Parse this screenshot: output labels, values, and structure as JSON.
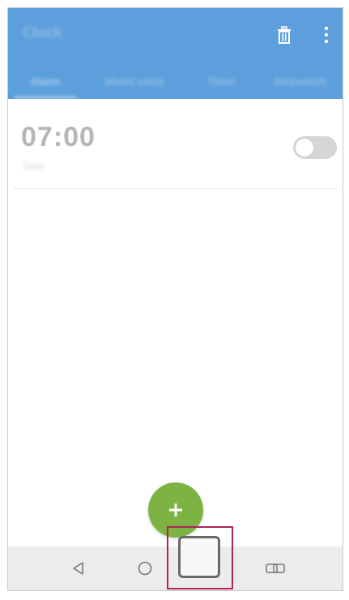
{
  "appbar": {
    "title": "Clock",
    "tabs": [
      {
        "label": "Alarm",
        "active": true
      },
      {
        "label": "World clock",
        "active": false
      },
      {
        "label": "Timer",
        "active": false
      },
      {
        "label": "Stopwatch",
        "active": false
      }
    ],
    "actions": {
      "delete_icon": "trash-icon",
      "more_icon": "more-vert-icon"
    },
    "color": "#5d9fdc"
  },
  "alarms": [
    {
      "time": "07:00",
      "label": "Daily",
      "enabled": false
    }
  ],
  "fab": {
    "icon": "plus-icon",
    "color": "#7cb342"
  },
  "navigation_bar": {
    "buttons": [
      "back-icon",
      "home-icon",
      "recent-apps-icon",
      "dual-window-icon"
    ],
    "highlighted": "recent-apps-icon",
    "highlight_color": "#b0245a"
  }
}
